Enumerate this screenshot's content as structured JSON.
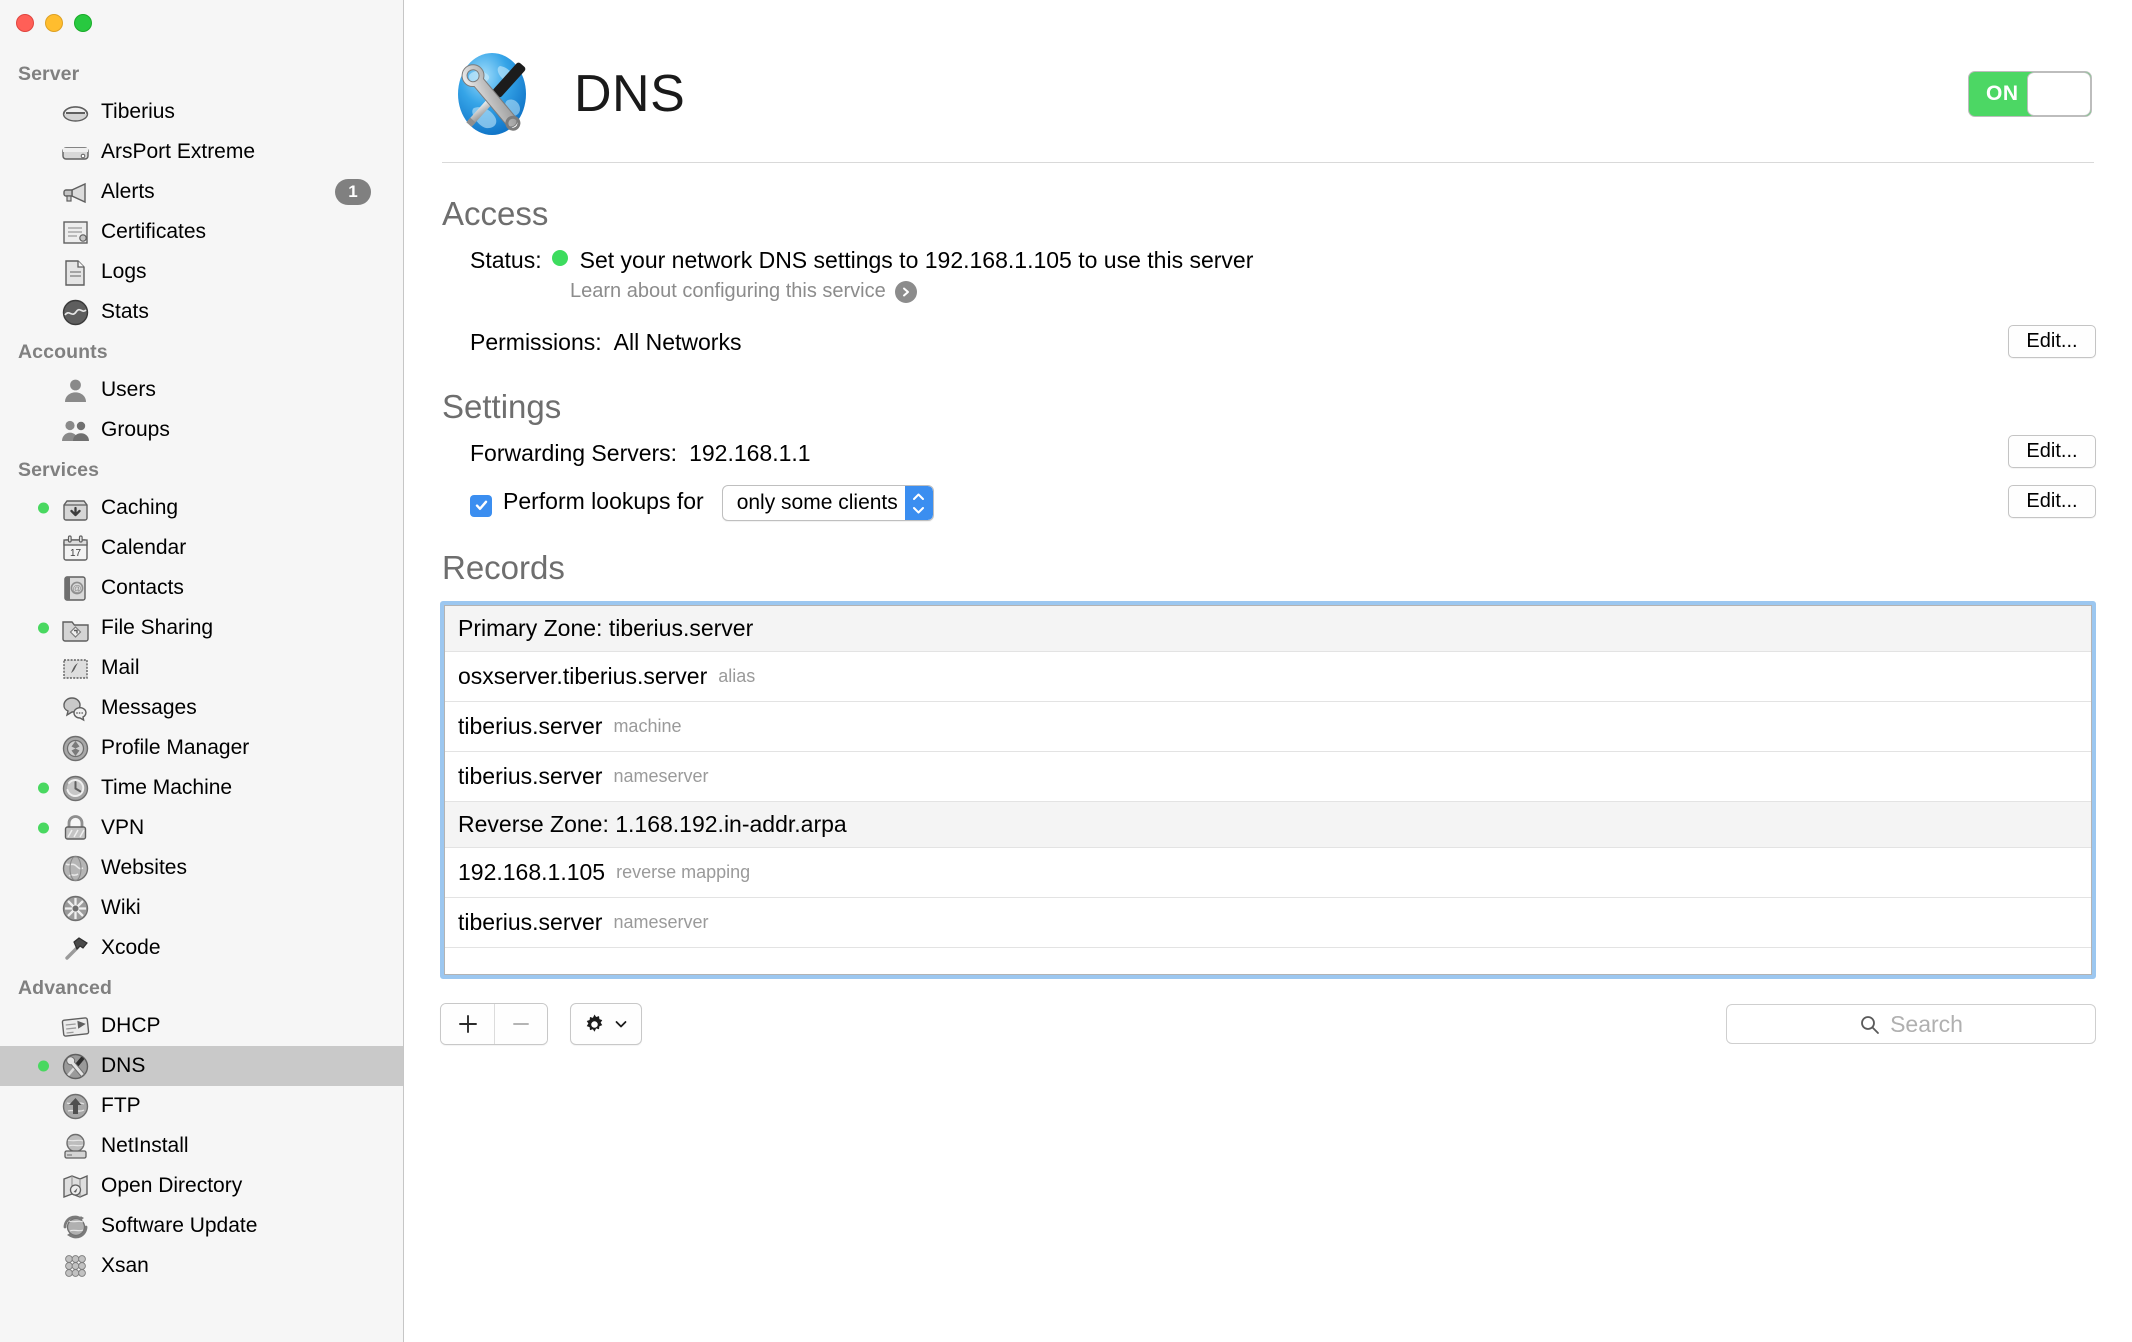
{
  "window": {
    "traffic_lights": [
      "close",
      "minimize",
      "zoom"
    ]
  },
  "sidebar": {
    "groups": [
      {
        "title": "Server",
        "items": [
          {
            "label": "Tiberius",
            "icon": "server-icon",
            "running": false,
            "badge": null
          },
          {
            "label": "ArsPort Extreme",
            "icon": "airport-icon",
            "running": false,
            "badge": null
          },
          {
            "label": "Alerts",
            "icon": "megaphone-icon",
            "running": false,
            "badge": "1"
          },
          {
            "label": "Certificates",
            "icon": "certificate-icon",
            "running": false,
            "badge": null
          },
          {
            "label": "Logs",
            "icon": "document-icon",
            "running": false,
            "badge": null
          },
          {
            "label": "Stats",
            "icon": "stats-icon",
            "running": false,
            "badge": null
          }
        ]
      },
      {
        "title": "Accounts",
        "items": [
          {
            "label": "Users",
            "icon": "user-icon",
            "running": false,
            "badge": null
          },
          {
            "label": "Groups",
            "icon": "group-icon",
            "running": false,
            "badge": null
          }
        ]
      },
      {
        "title": "Services",
        "items": [
          {
            "label": "Caching",
            "icon": "caching-icon",
            "running": true,
            "badge": null
          },
          {
            "label": "Calendar",
            "icon": "calendar-icon",
            "running": false,
            "badge": null
          },
          {
            "label": "Contacts",
            "icon": "contacts-icon",
            "running": false,
            "badge": null
          },
          {
            "label": "File Sharing",
            "icon": "file-sharing-icon",
            "running": true,
            "badge": null
          },
          {
            "label": "Mail",
            "icon": "mail-icon",
            "running": false,
            "badge": null
          },
          {
            "label": "Messages",
            "icon": "messages-icon",
            "running": false,
            "badge": null
          },
          {
            "label": "Profile Manager",
            "icon": "profile-manager-icon",
            "running": false,
            "badge": null
          },
          {
            "label": "Time Machine",
            "icon": "time-machine-icon",
            "running": true,
            "badge": null
          },
          {
            "label": "VPN",
            "icon": "lock-icon",
            "running": true,
            "badge": null
          },
          {
            "label": "Websites",
            "icon": "globe-icon",
            "running": false,
            "badge": null
          },
          {
            "label": "Wiki",
            "icon": "wiki-icon",
            "running": false,
            "badge": null
          },
          {
            "label": "Xcode",
            "icon": "hammer-icon",
            "running": false,
            "badge": null
          }
        ]
      },
      {
        "title": "Advanced",
        "items": [
          {
            "label": "DHCP",
            "icon": "dhcp-icon",
            "running": false,
            "badge": null
          },
          {
            "label": "DNS",
            "icon": "dns-icon",
            "running": true,
            "badge": null,
            "selected": true
          },
          {
            "label": "FTP",
            "icon": "ftp-icon",
            "running": false,
            "badge": null
          },
          {
            "label": "NetInstall",
            "icon": "netinstall-icon",
            "running": false,
            "badge": null
          },
          {
            "label": "Open Directory",
            "icon": "open-directory-icon",
            "running": false,
            "badge": null
          },
          {
            "label": "Software Update",
            "icon": "software-update-icon",
            "running": false,
            "badge": null
          },
          {
            "label": "Xsan",
            "icon": "xsan-icon",
            "running": false,
            "badge": null
          }
        ]
      }
    ]
  },
  "header": {
    "title": "DNS",
    "icon": "dns-globe-tools-icon",
    "toggle_state": "ON"
  },
  "access": {
    "section_title": "Access",
    "status_label": "Status:",
    "status_text": "Set your network DNS settings to 192.168.1.105 to use this server",
    "status_color": "#3ddc5e",
    "learn_more": "Learn about configuring this service",
    "permissions_label": "Permissions:",
    "permissions_value": "All Networks",
    "permissions_edit": "Edit..."
  },
  "settings": {
    "section_title": "Settings",
    "forwarding_label": "Forwarding Servers:",
    "forwarding_value": "192.168.1.1",
    "forwarding_edit": "Edit...",
    "lookups_checked": true,
    "lookups_label": "Perform lookups for",
    "lookups_selected": "only some clients",
    "lookups_options": [
      "only some clients"
    ],
    "lookups_edit": "Edit..."
  },
  "records": {
    "section_title": "Records",
    "rows": [
      {
        "name": "Primary Zone: tiberius.server",
        "type": "",
        "is_zone": true
      },
      {
        "name": "osxserver.tiberius.server",
        "type": "alias",
        "is_zone": false
      },
      {
        "name": "tiberius.server",
        "type": "machine",
        "is_zone": false
      },
      {
        "name": "tiberius.server",
        "type": "nameserver",
        "is_zone": false
      },
      {
        "name": "Reverse Zone: 1.168.192.in-addr.arpa",
        "type": "",
        "is_zone": true
      },
      {
        "name": "192.168.1.105",
        "type": "reverse mapping",
        "is_zone": false
      },
      {
        "name": "tiberius.server",
        "type": "nameserver",
        "is_zone": false
      },
      {
        "name": "",
        "type": "",
        "is_zone": false
      },
      {
        "name": "",
        "type": "",
        "is_zone": false
      }
    ]
  },
  "toolbar": {
    "add_label": "+",
    "remove_label": "–",
    "gear_label": "gear-icon",
    "search_placeholder": "Search",
    "search_value": ""
  }
}
